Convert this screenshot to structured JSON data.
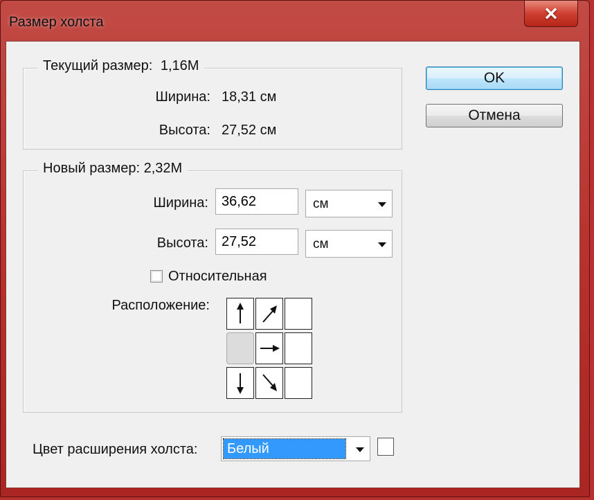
{
  "window": {
    "title": "Размер холста",
    "close_label": "✕"
  },
  "current": {
    "legend": "Текущий размер:",
    "size": "1,16M",
    "width_label": "Ширина:",
    "width_value": "18,31 см",
    "height_label": "Высота:",
    "height_value": "27,52 см"
  },
  "new": {
    "legend": "Новый размер: 2,32M",
    "width_label": "Ширина:",
    "width_value": "36,62",
    "width_unit": "см",
    "height_label": "Высота:",
    "height_value": "27,52",
    "height_unit": "см",
    "relative_label": "Относительная",
    "relative_checked": false,
    "anchor_label": "Расположение:",
    "anchor_cells": [
      "arrow-up-icon",
      "arrow-up-right-icon",
      "blank",
      "anchor-center",
      "arrow-right-icon",
      "blank",
      "arrow-down-icon",
      "arrow-down-right-icon",
      "blank"
    ]
  },
  "extension": {
    "label": "Цвет расширения холста:",
    "value": "Белый",
    "swatch_color": "#ffffff"
  },
  "buttons": {
    "ok": "OK",
    "cancel": "Отмена"
  },
  "colors": {
    "titlebar": "#b7302d",
    "selection": "#3399ff",
    "dialog_bg": "#f0f0f0"
  }
}
